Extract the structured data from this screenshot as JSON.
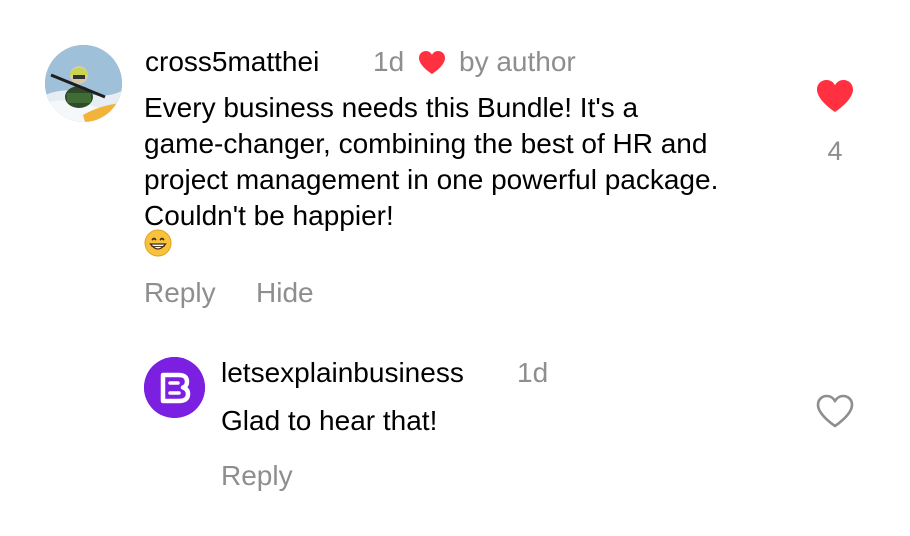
{
  "comment": {
    "username": "cross5matthei",
    "time": "1d",
    "liked_by_author_label": "by author",
    "text": "Every business needs this Bundle! It's a game-changer, combining the best of HR and project management in one powerful package. Couldn't be happier!",
    "emoji": "grinning-face-with-smiling-eyes",
    "like_count": "4",
    "liked": true,
    "actions": {
      "reply": "Reply",
      "hide": "Hide"
    }
  },
  "reply": {
    "username": "letsexplainbusiness",
    "time": "1d",
    "text": "Glad to hear that!",
    "liked": false,
    "actions": {
      "reply": "Reply"
    }
  },
  "colors": {
    "heart_red": "#ff3040",
    "meta_gray": "#8e8e8e",
    "brand_purple": "#7b1fe0"
  }
}
